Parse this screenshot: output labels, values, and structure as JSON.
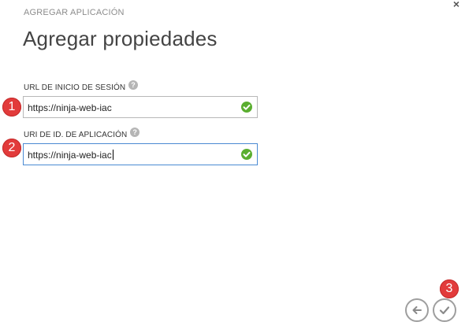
{
  "dialog": {
    "subtitle": "AGREGAR APLICACIÓN",
    "title": "Agregar propiedades",
    "close_symbol": "×",
    "close_icon": "close-icon"
  },
  "fields": [
    {
      "label": "URL DE INICIO DE SESIÓN",
      "help_symbol": "?",
      "value": "https://ninja-web-iac",
      "status": "valid",
      "focused": false
    },
    {
      "label": "URI DE ID. DE APLICACIÓN",
      "help_symbol": "?",
      "value": "https://ninja-web-iac",
      "status": "valid",
      "focused": true
    }
  ],
  "step_markers": [
    "1",
    "2",
    "3"
  ],
  "navigation": {
    "back_icon": "arrow-left-icon",
    "complete_icon": "checkmark-icon"
  },
  "colors": {
    "valid_check": "#5aae2f",
    "step_marker": "#e23b3b",
    "focus_border": "#4a8ad3"
  }
}
